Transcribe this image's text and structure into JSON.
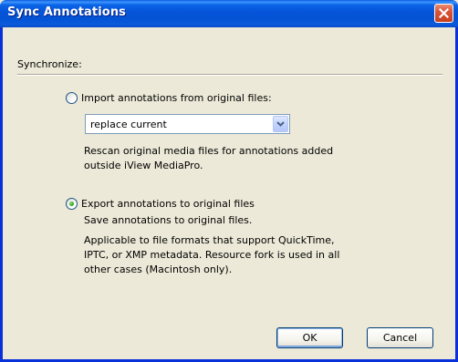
{
  "window": {
    "title": "Sync Annotations"
  },
  "group": {
    "label": "Synchronize:"
  },
  "import_option": {
    "label": "Import annotations from original files:",
    "checked": false,
    "select_value": "replace current",
    "description": "Rescan original media files for annotations added\noutside iView MediaPro."
  },
  "export_option": {
    "label": "Export annotations to original files",
    "checked": true,
    "description1": "Save annotations to original files.",
    "description2": "Applicable to file formats that support QuickTime,\nIPTC, or XMP metadata. Resource fork is used in all\nother cases (Macintosh only)."
  },
  "buttons": {
    "ok": "OK",
    "cancel": "Cancel"
  },
  "colors": {
    "titlebar": "#0453d4",
    "face": "#ece9d8",
    "close": "#d9543a"
  },
  "icons": {
    "close": "close-icon",
    "dropdown": "chevron-down-icon"
  }
}
